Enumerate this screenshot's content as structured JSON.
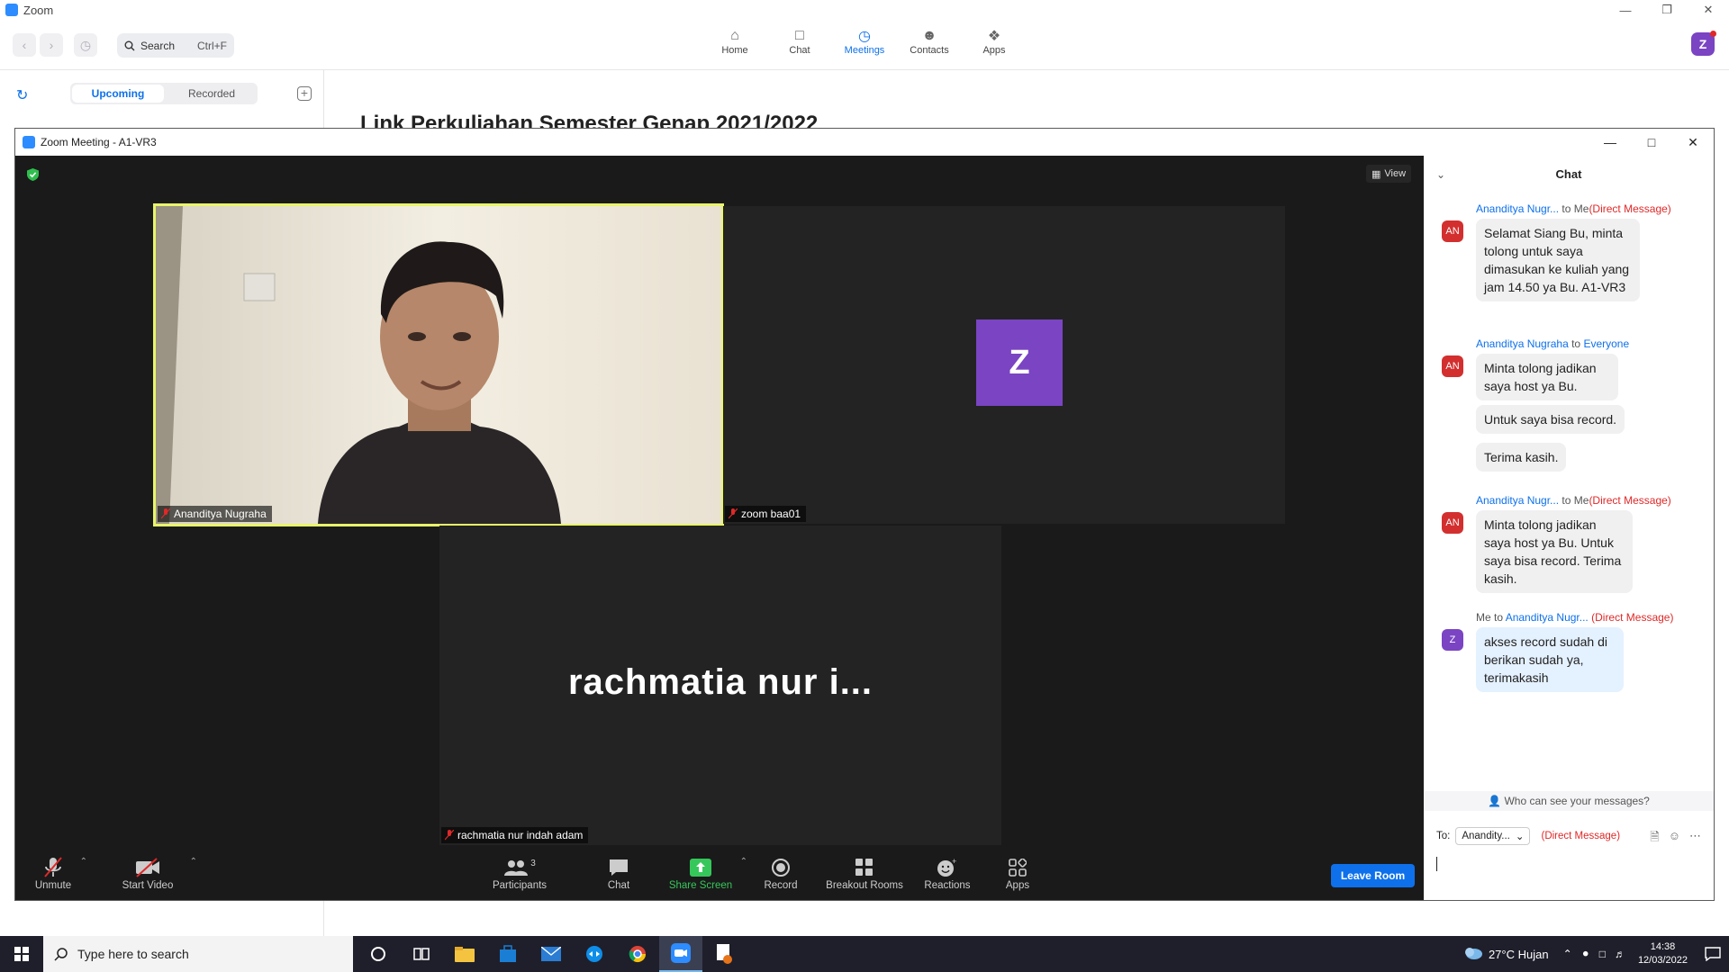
{
  "app": {
    "title": "Zoom",
    "search_label": "Search",
    "search_shortcut": "Ctrl+F",
    "nav": [
      {
        "label": "Home",
        "icon": "home-icon"
      },
      {
        "label": "Chat",
        "icon": "chat-icon"
      },
      {
        "label": "Meetings",
        "icon": "clock-icon",
        "active": true
      },
      {
        "label": "Contacts",
        "icon": "contacts-icon"
      },
      {
        "label": "Apps",
        "icon": "apps-icon"
      }
    ],
    "avatar_letter": "Z",
    "tabs": {
      "upcoming": "Upcoming",
      "recorded": "Recorded"
    },
    "heading": "Link Perkuliahan Semester Genap 2021/2022"
  },
  "meeting": {
    "title": "Zoom Meeting - A1-VR3",
    "view_label": "View",
    "tiles": {
      "speaker_name": "Ananditya Nugraha",
      "zoom_avatar_letter": "Z",
      "zoom_name": "zoom baa01",
      "rach_big_name": "rachmatia nur i...",
      "rach_name": "rachmatia nur indah adam"
    },
    "toolbar": {
      "unmute": "Unmute",
      "start_video": "Start Video",
      "participants": "Participants",
      "participants_count": "3",
      "chat": "Chat",
      "share_screen": "Share Screen",
      "record": "Record",
      "breakout_rooms": "Breakout Rooms",
      "reactions": "Reactions",
      "apps": "Apps",
      "leave": "Leave Room"
    }
  },
  "chat": {
    "title": "Chat",
    "messages": [
      {
        "sender": "Ananditya Nugr...",
        "to_prefix": "to",
        "to": "Me",
        "dm": "(Direct Message)",
        "avatar": "AN",
        "bubbles": [
          "Selamat Siang Bu, minta tolong untuk saya dimasukan ke kuliah yang jam 14.50 ya Bu. A1-VR3"
        ]
      },
      {
        "sender": "Ananditya Nugraha",
        "to_prefix": "to",
        "to": "Everyone",
        "dm": "",
        "avatar": "AN",
        "bubbles": [
          "Minta tolong jadikan saya host ya Bu.",
          "Untuk saya bisa record.",
          "Terima kasih."
        ]
      },
      {
        "sender": "Ananditya Nugr...",
        "to_prefix": "to",
        "to": "Me",
        "dm": "(Direct Message)",
        "avatar": "AN",
        "bubbles": [
          "Minta tolong jadikan saya host ya Bu. Untuk saya bisa record. Terima kasih."
        ]
      },
      {
        "sender": "Me",
        "to_prefix": "to",
        "to": "Ananditya Nugr...",
        "dm": "(Direct Message)",
        "avatar": "Z",
        "bubbles": [
          "akses record sudah di berikan sudah ya, terimakasih"
        ]
      }
    ],
    "who_can_see": "Who can see your messages?",
    "to_label": "To:",
    "to_value": "Anandity...",
    "to_dm": "(Direct Message)"
  },
  "taskbar": {
    "search_placeholder": "Type here to search",
    "weather": "27°C  Hujan",
    "time": "14:38",
    "date": "12/03/2022"
  },
  "colors": {
    "accent": "#0e71eb",
    "speaker_border": "#e9f56a",
    "avatar_purple": "#7a44c3",
    "avatar_red": "#d32f2f",
    "share_green": "#36c75b",
    "dm_red": "#e02828"
  }
}
